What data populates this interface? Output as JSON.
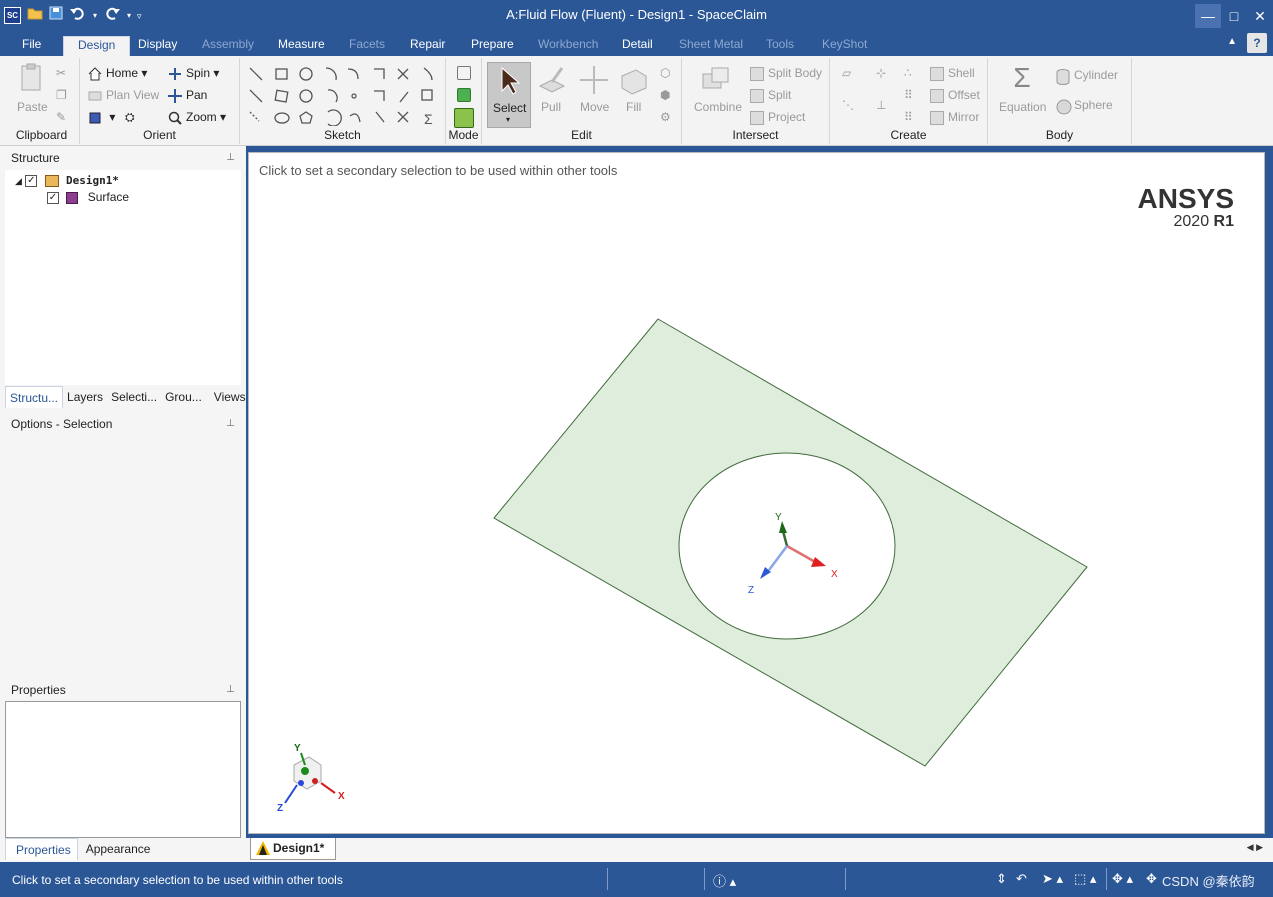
{
  "window": {
    "title": "A:Fluid Flow (Fluent) - Design1 - SpaceClaim",
    "app_icon": "SC",
    "minimize": "—",
    "maximize": "□",
    "close": "✕"
  },
  "menu_tabs": [
    "File",
    "Design",
    "Display",
    "Assembly",
    "Measure",
    "Facets",
    "Repair",
    "Prepare",
    "Workbench",
    "Detail",
    "Sheet Metal",
    "Tools",
    "KeyShot"
  ],
  "ribbon": {
    "clipboard": {
      "paste": "Paste",
      "label": "Clipboard"
    },
    "orient": {
      "home": "Home",
      "spin": "Spin",
      "plan_view": "Plan View",
      "pan": "Pan",
      "zoom": "Zoom",
      "label": "Orient"
    },
    "sketch": {
      "label": "Sketch"
    },
    "mode": {
      "label": "Mode"
    },
    "edit": {
      "select": "Select",
      "pull": "Pull",
      "move": "Move",
      "fill": "Fill",
      "label": "Edit"
    },
    "intersect": {
      "combine": "Combine",
      "split_body": "Split Body",
      "split": "Split",
      "project": "Project",
      "label": "Intersect"
    },
    "create": {
      "shell": "Shell",
      "offset": "Offset",
      "mirror": "Mirror",
      "label": "Create"
    },
    "body": {
      "equation": "Equation",
      "cylinder": "Cylinder",
      "sphere": "Sphere",
      "label": "Body"
    }
  },
  "structure": {
    "header": "Structure",
    "root": "Design1*",
    "child": "Surface",
    "tabs": [
      "Structu...",
      "Layers",
      "Selecti...",
      "Grou...",
      "Views"
    ]
  },
  "options": {
    "header": "Options - Selection"
  },
  "properties": {
    "header": "Properties",
    "tabs": [
      "Properties",
      "Appearance"
    ]
  },
  "viewport": {
    "hint": "Click to set a secondary selection to be used within other tools",
    "logo": "ANSYS",
    "version": "2020",
    "release": "R1",
    "axis_x": "X",
    "axis_y": "Y",
    "axis_z": "Z"
  },
  "doc_tab": {
    "label": "Design1*",
    "close": "×"
  },
  "status": {
    "text": "Click to set a secondary selection to be used within other tools",
    "watermark": "CSDN @秦依韵"
  },
  "colors": {
    "accent": "#2b5797",
    "surface_fill": "#dfeddd",
    "surface_edge": "#3f6b3a"
  }
}
